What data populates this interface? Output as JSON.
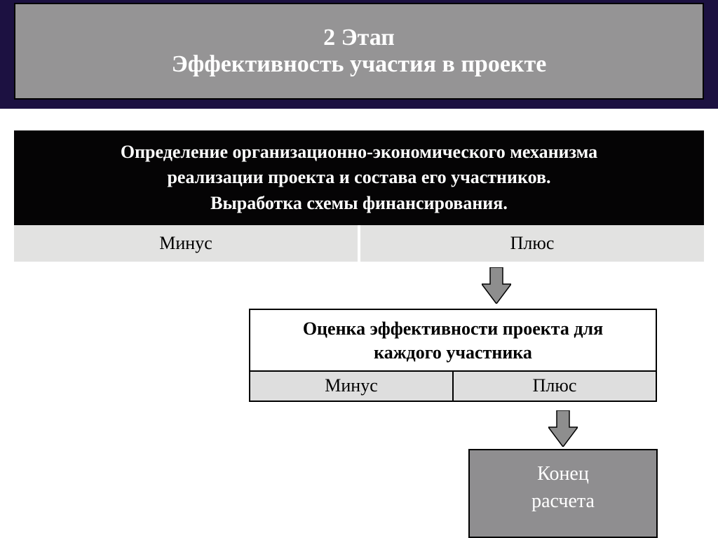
{
  "header": {
    "line1": "2 Этап",
    "line2": "Эффективность участия в проекте"
  },
  "description": {
    "line1": "Определение организационно-экономического механизма",
    "line2": "реализации проекта и состава его участников.",
    "line3": "Выработка схемы финансирования."
  },
  "decision1": {
    "left": "Минус",
    "right": "Плюс"
  },
  "evaluation": {
    "title_line1": "Оценка  эффективности проекта для",
    "title_line2": "каждого участника",
    "left": "Минус",
    "right": "Плюс"
  },
  "end": {
    "line1": "Конец",
    "line2": "расчета"
  },
  "colors": {
    "header_band": "#1c1141",
    "header_inner": "#959495",
    "black_box": "#050405",
    "arrow_fill": "#8e8e8e",
    "light_row": "#e2e2e1",
    "eval_row": "#dedede",
    "end_box": "#8f8e90"
  }
}
